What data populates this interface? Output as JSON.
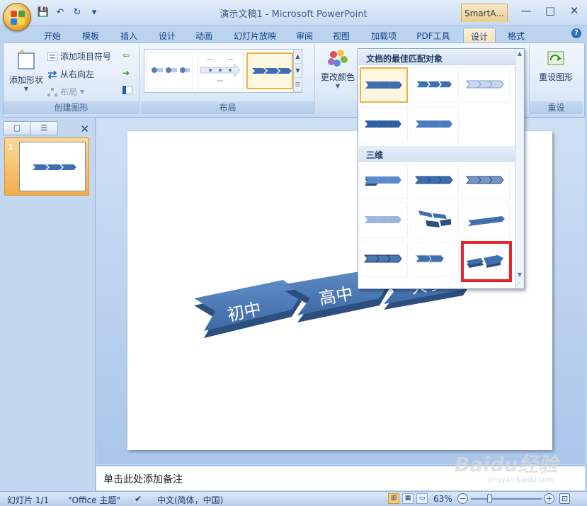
{
  "window": {
    "title": "演示文稿1 - Microsoft PowerPoint",
    "contextual_tab_group": "SmartA...",
    "window_buttons": [
      "—",
      "□",
      "✕"
    ]
  },
  "qat": {
    "save": "💾",
    "undo": "↶",
    "redo": "↻",
    "more": "▾"
  },
  "tabs": [
    "开始",
    "模板",
    "插入",
    "设计",
    "动画",
    "幻灯片放映",
    "审阅",
    "视图",
    "加载项",
    "PDF工具",
    "设计",
    "格式"
  ],
  "active_tab": "设计",
  "ribbon": {
    "create_graphic": {
      "label": "创建图形",
      "add_shape": "添加形状",
      "add_bullet": "添加项目符号",
      "right_to_left": "从右向左",
      "layout": "布局"
    },
    "layouts": {
      "label": "布局"
    },
    "smartart_styles": {
      "change_colors": "更改颜色"
    },
    "reset": {
      "label": "重设",
      "reset_graphic": "重设图形"
    }
  },
  "dropdown": {
    "section1": "文档的最佳匹配对象",
    "section2": "三维",
    "highlighted_index": 8
  },
  "slides_panel": {
    "tab_slides_icon": "slides-icon",
    "tab_outline_icon": "outline-icon",
    "close": "✕",
    "slide_number": "1"
  },
  "slide": {
    "shapes": [
      "初中",
      "高中",
      "大学"
    ]
  },
  "notes": {
    "placeholder": "单击此处添加备注"
  },
  "status": {
    "slide_info": "幻灯片 1/1",
    "theme": "\"Office 主题\"",
    "language": "中文(简体，中国)",
    "zoom": "63%",
    "zoom_minus": "−",
    "zoom_plus": "+",
    "fit": "⊡"
  },
  "watermark": {
    "main": "Baidu经验",
    "sub": "jingyan.baidu.com"
  },
  "colors": {
    "accent_orange": "#f0b43b",
    "highlight_red": "#e8232a",
    "chevron_blue": "#3f6fae"
  }
}
